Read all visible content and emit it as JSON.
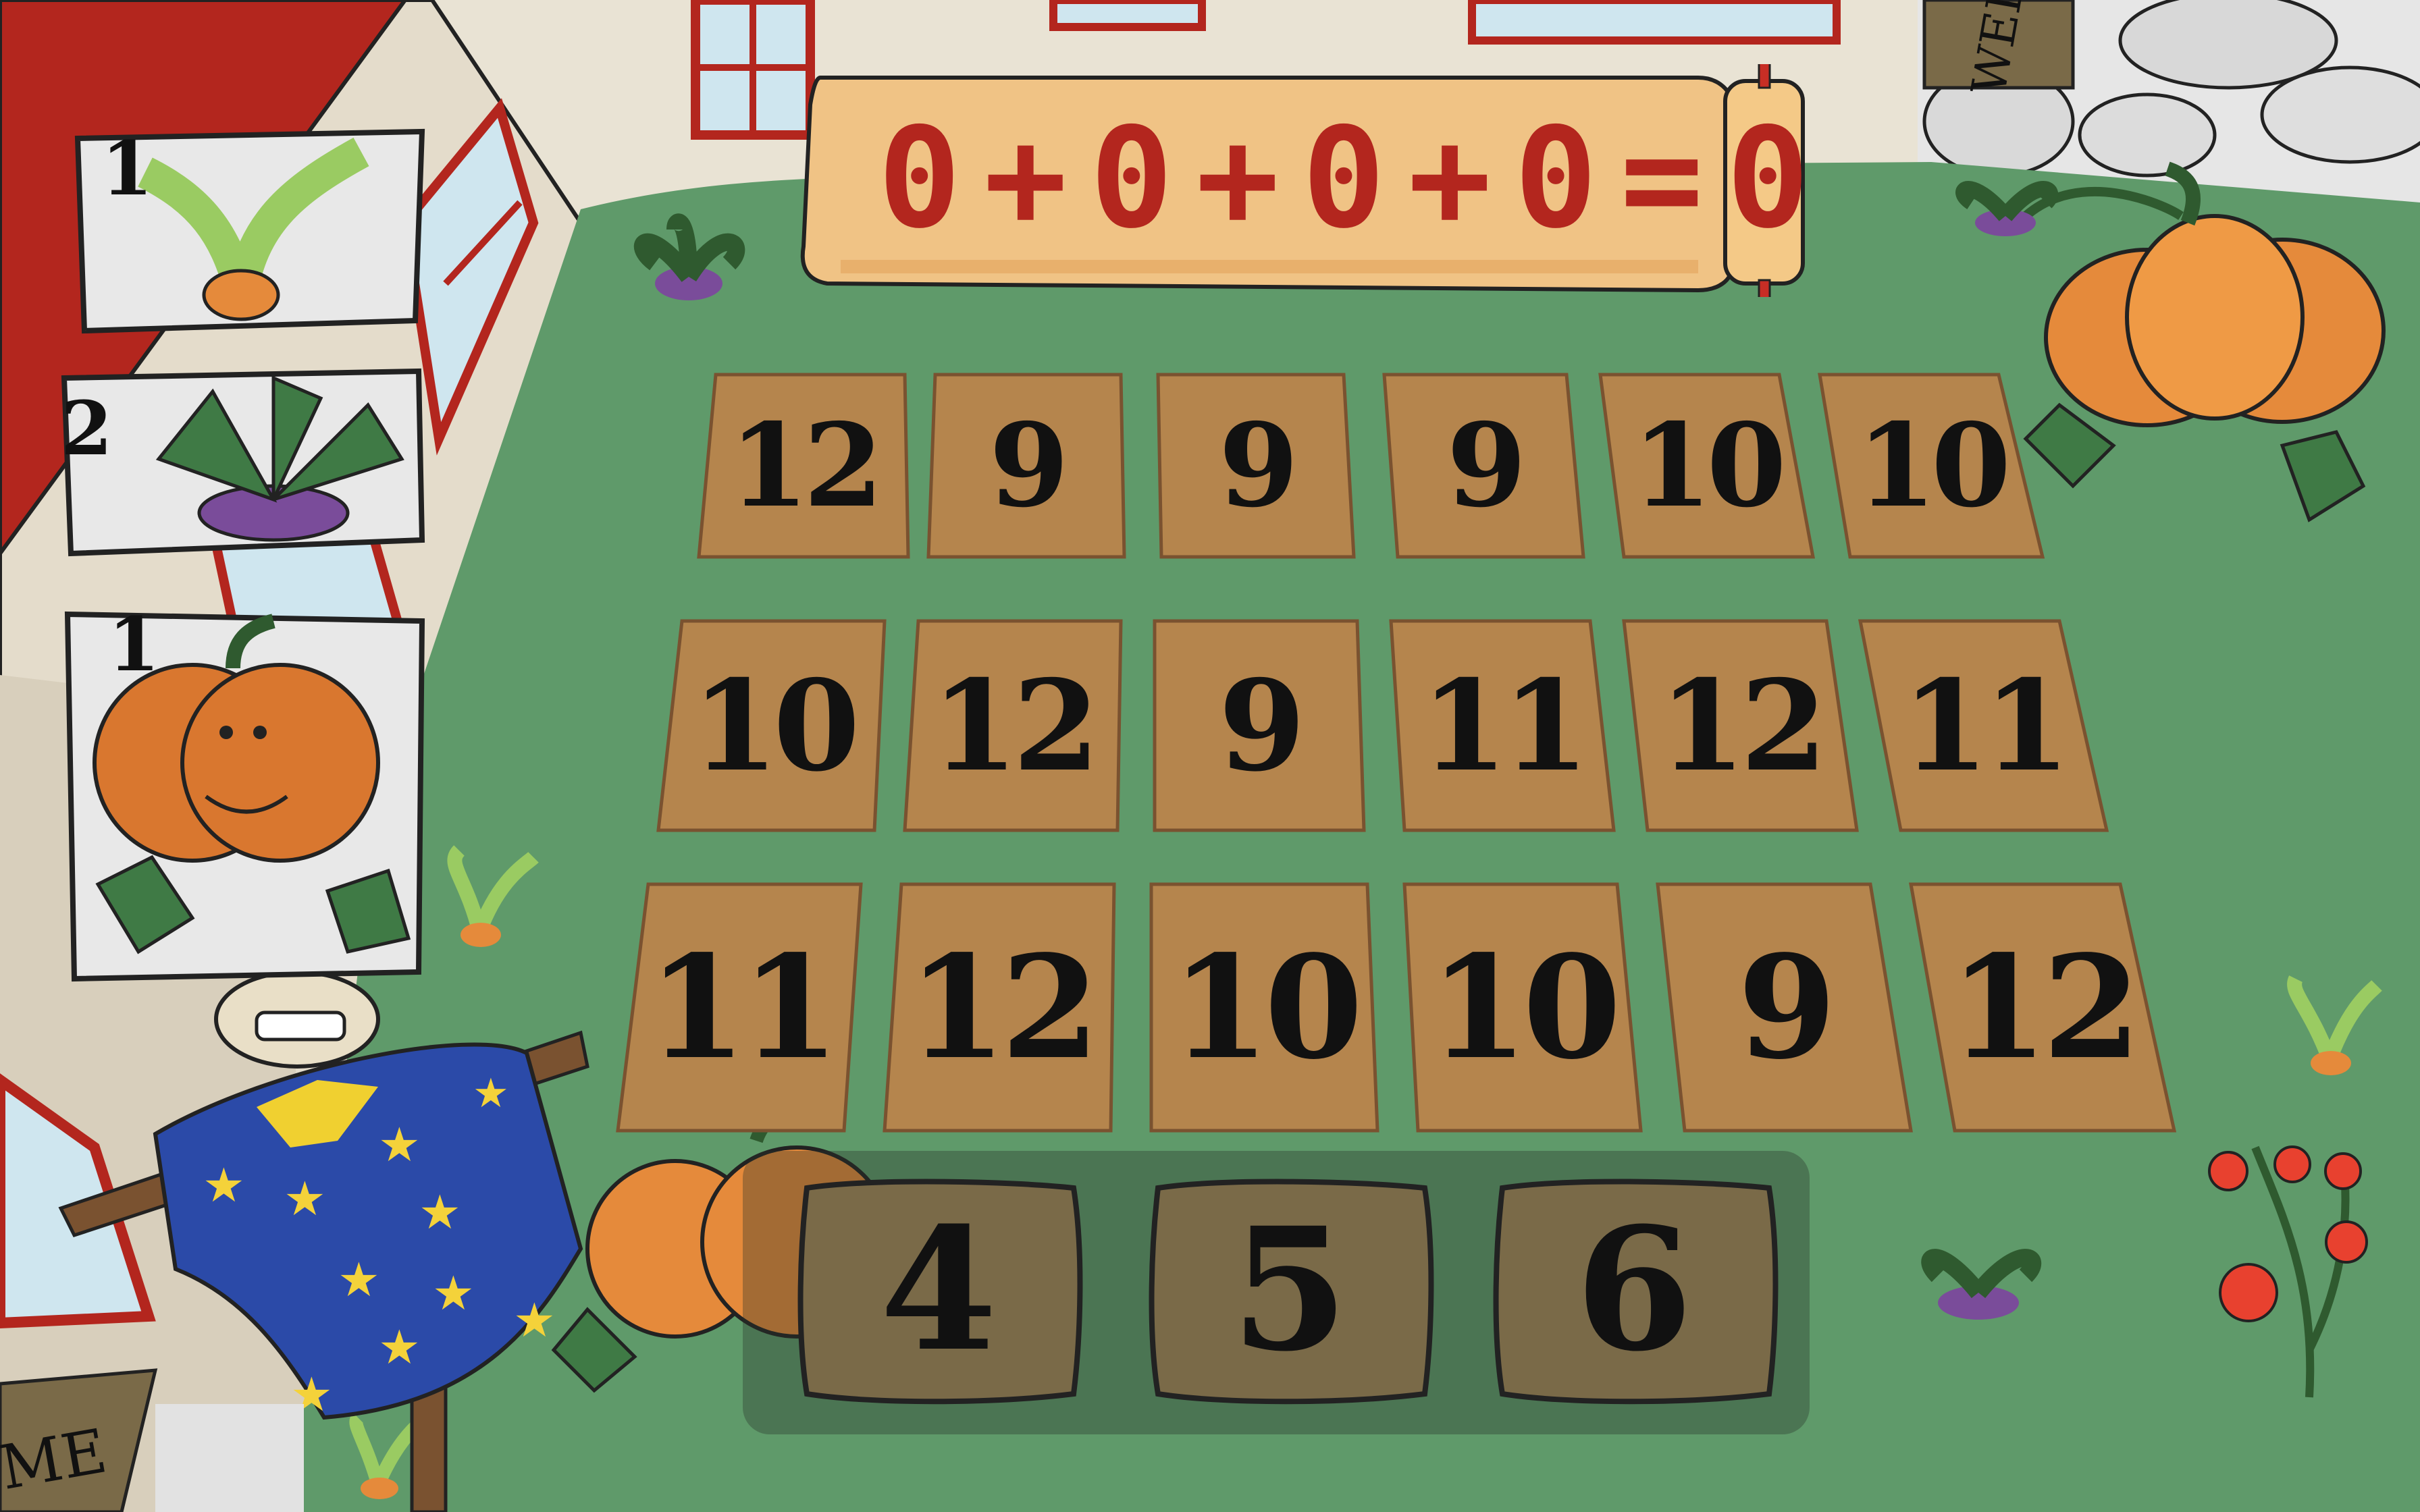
{
  "equation": {
    "parts": [
      "0",
      "+",
      "0",
      "+",
      "0",
      "+",
      "0",
      "=",
      "0"
    ]
  },
  "counters": [
    {
      "count": "1",
      "icon": "carrot-icon"
    },
    {
      "count": "2",
      "icon": "turnip-icon"
    },
    {
      "count": "1",
      "icon": "pumpkin-icon"
    }
  ],
  "board": {
    "rows": [
      [
        "12",
        "9",
        "9",
        "9",
        "10",
        "10"
      ],
      [
        "10",
        "12",
        "9",
        "11",
        "12",
        "11"
      ],
      [
        "11",
        "12",
        "10",
        "10",
        "9",
        "12"
      ]
    ]
  },
  "answers": [
    "4",
    "5",
    "6"
  ],
  "signs": {
    "top_right": "WEL",
    "bottom_left": "ME"
  },
  "colors": {
    "grass": "#5f9a6a",
    "tile": "#b5854d",
    "card": "#7a6a48",
    "equation_text": "#b3261e",
    "scroll": "#f0c385",
    "barn_red": "#b3261e"
  }
}
